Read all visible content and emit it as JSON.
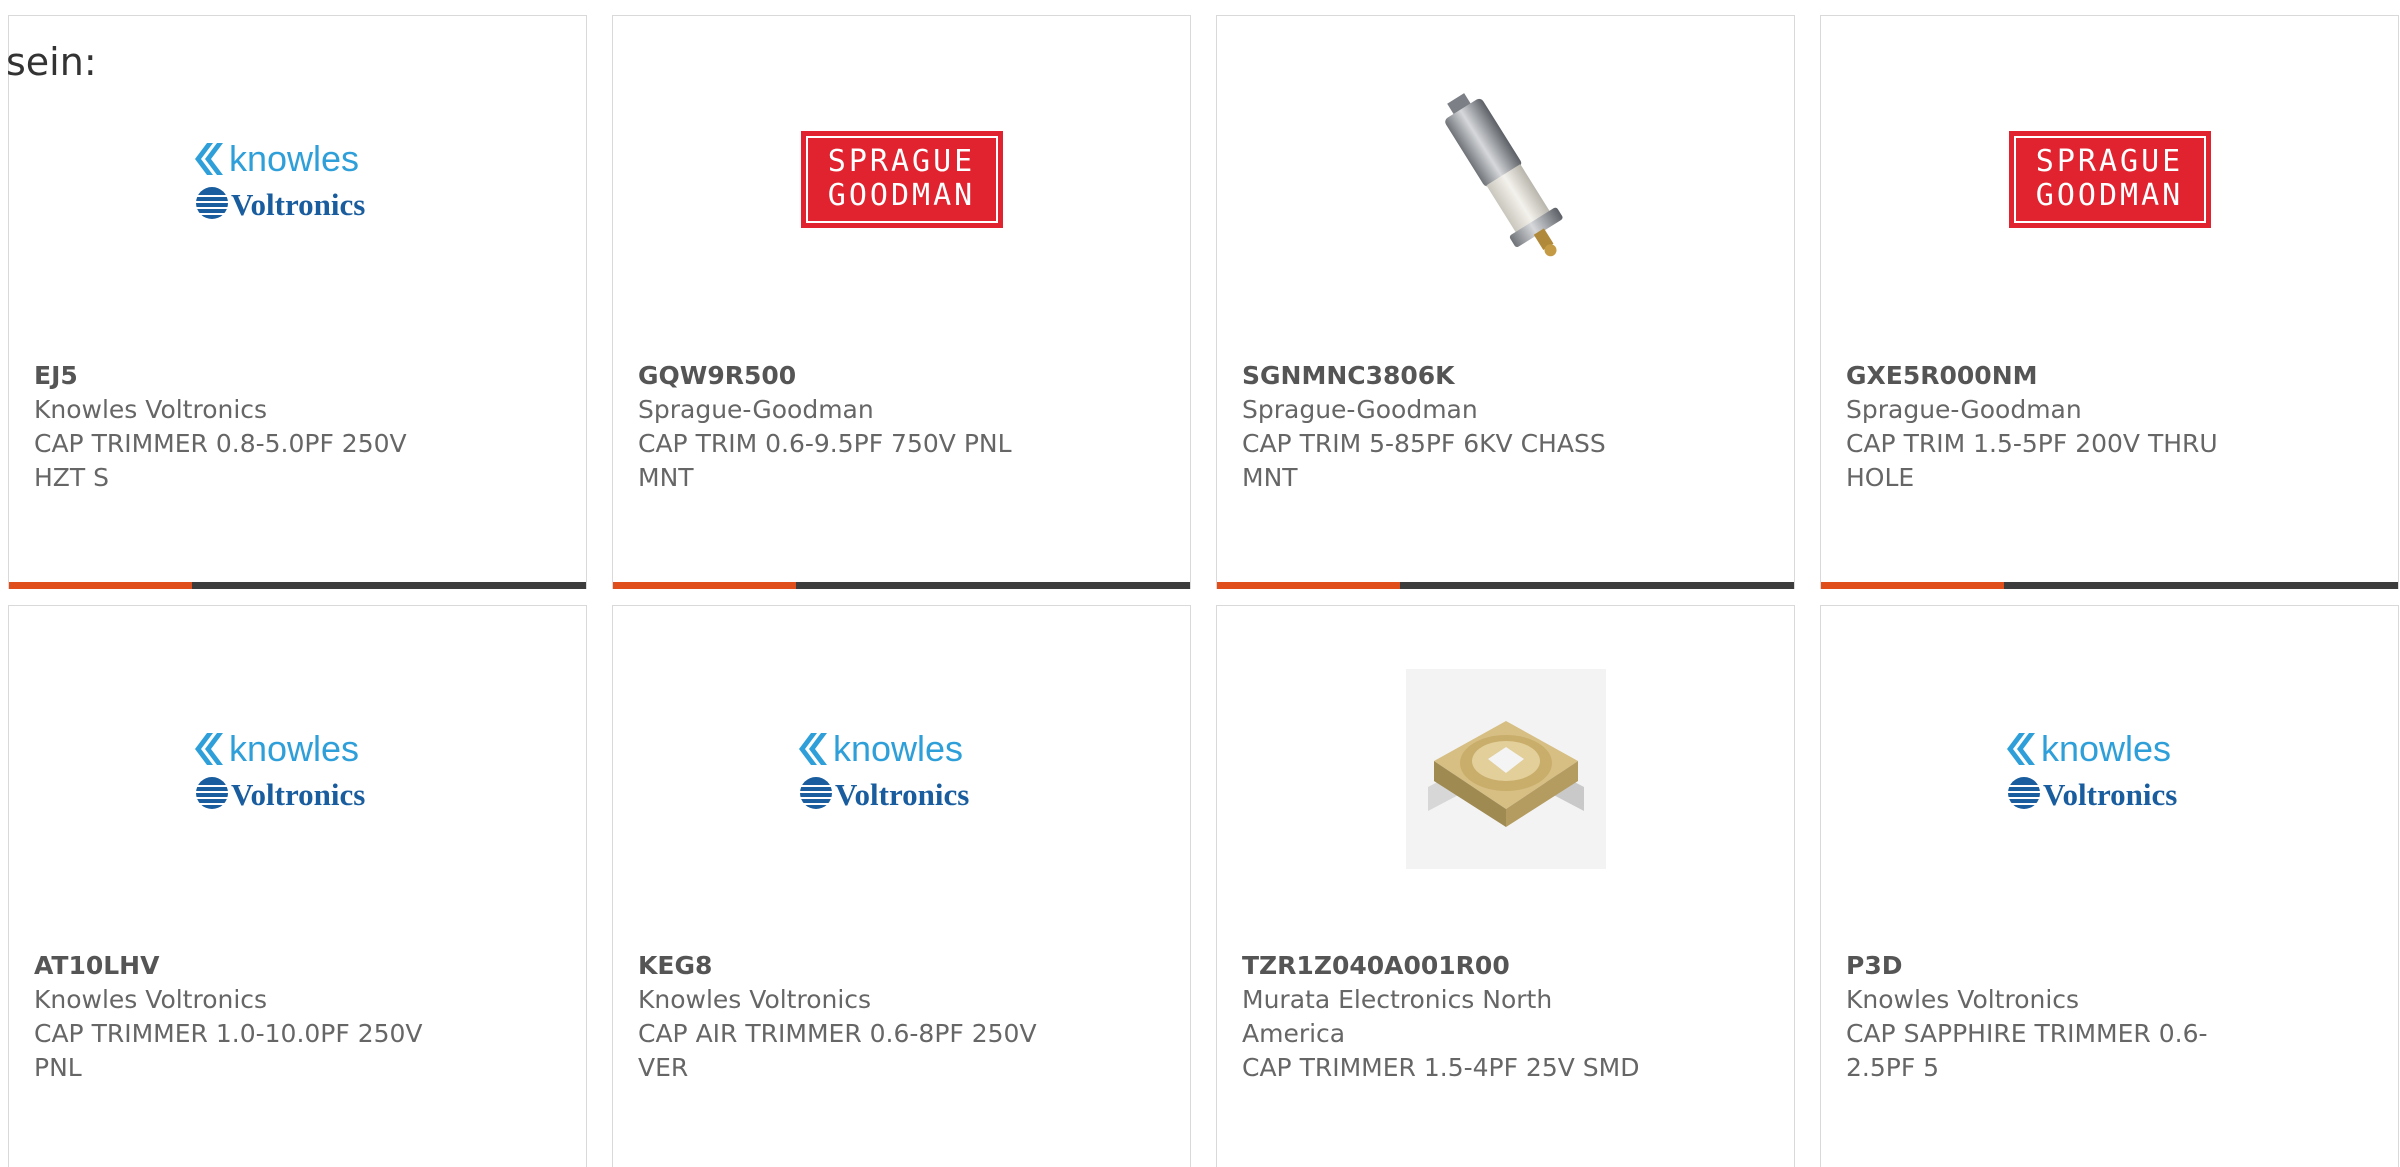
{
  "header_text": "sein:",
  "colors": {
    "accent_orange": "#e04e1c",
    "bar_dark": "#3c3c3c",
    "sprague_red": "#e0232e",
    "knowles_blue": "#2e9fd9",
    "voltronics_navy": "#1a5d9e"
  },
  "logos": {
    "knowles_text": "knowles",
    "voltronics_text": "Voltronics",
    "sprague_line1": "SPRAGUE",
    "sprague_line2": "GOODMAN"
  },
  "products": [
    {
      "part_number": "EJ5",
      "manufacturer": "Knowles Voltronics",
      "description_line1": "CAP TRIMMER 0.8-5.0PF 250V",
      "description_line2": "HZT S",
      "image": "knowles-voltronics-logo"
    },
    {
      "part_number": "GQW9R500",
      "manufacturer": "Sprague-Goodman",
      "description_line1": "CAP TRIM 0.6-9.5PF 750V PNL",
      "description_line2": "MNT",
      "image": "sprague-goodman-logo"
    },
    {
      "part_number": "SGNMNC3806K",
      "manufacturer": "Sprague-Goodman",
      "description_line1": "CAP TRIM 5-85PF 6KV CHASS",
      "description_line2": "MNT",
      "image": "trimmer-capacitor-photo"
    },
    {
      "part_number": "GXE5R000NM",
      "manufacturer": "Sprague-Goodman",
      "description_line1": "CAP TRIM 1.5-5PF 200V THRU",
      "description_line2": "HOLE",
      "image": "sprague-goodman-logo"
    },
    {
      "part_number": "AT10LHV",
      "manufacturer": "Knowles Voltronics",
      "description_line1": "CAP TRIMMER 1.0-10.0PF 250V",
      "description_line2": "PNL",
      "image": "knowles-voltronics-logo"
    },
    {
      "part_number": "KEG8",
      "manufacturer": "Knowles Voltronics",
      "description_line1": "CAP AIR TRIMMER 0.6-8PF 250V",
      "description_line2": "VER",
      "image": "knowles-voltronics-logo"
    },
    {
      "part_number": "TZR1Z040A001R00",
      "manufacturer": "Murata Electronics North America",
      "description_line1": "CAP TRIMMER 1.5-4PF 25V SMD",
      "description_line2": "",
      "image": "smd-trimmer-photo"
    },
    {
      "part_number": "P3D",
      "manufacturer": "Knowles Voltronics",
      "description_line1": "CAP SAPPHIRE TRIMMER 0.6-",
      "description_line2": "2.5PF 5",
      "image": "knowles-voltronics-logo"
    }
  ]
}
